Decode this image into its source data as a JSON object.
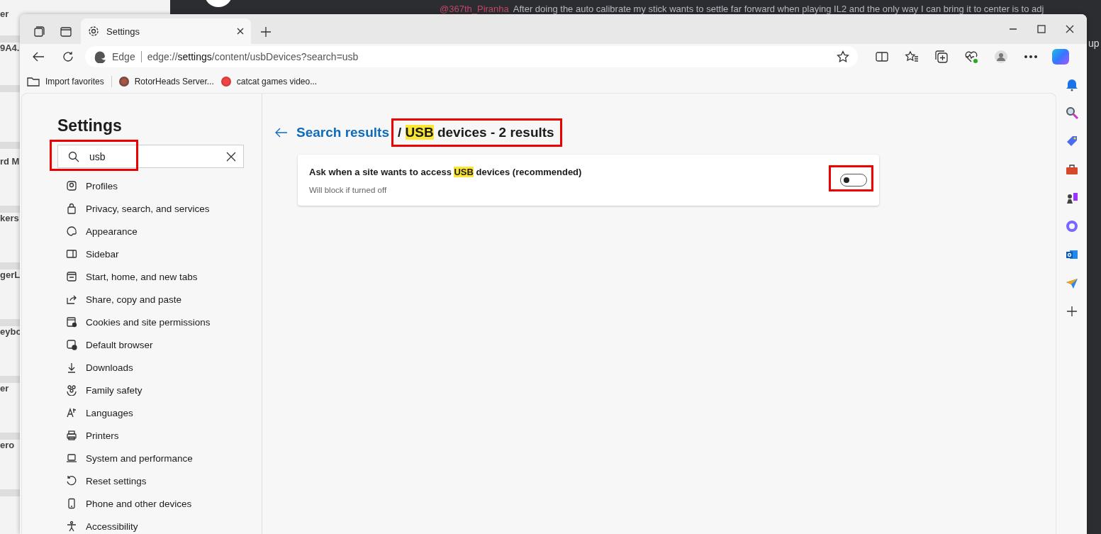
{
  "desktop": {
    "left_labels": [
      "er",
      "9A4.",
      "rd M",
      "kers",
      "gerL",
      "eybo",
      "er",
      "ero"
    ]
  },
  "chat": {
    "author": "@367th_Piranha",
    "message": "After doing the auto calibrate my stick wants to settle far forward when playing IL2 and the only way I can bring it to center is to adj",
    "side_text": "up"
  },
  "browser": {
    "tabs": [
      {
        "label": "Settings",
        "selected": true
      }
    ],
    "address": {
      "site_label": "Edge",
      "url": "edge://**settings**/content/usbDevices?search=usb"
    },
    "favorites": [
      {
        "label": "Import favorites",
        "kind": "import"
      },
      {
        "label": "RotorHeads Server...",
        "kind": "site"
      },
      {
        "label": "catcat games video...",
        "kind": "site"
      }
    ],
    "settings": {
      "title": "Settings",
      "search": {
        "value": "usb",
        "annotated": true
      },
      "nav": [
        {
          "label": "Profiles"
        },
        {
          "label": "Privacy, search, and services"
        },
        {
          "label": "Appearance"
        },
        {
          "label": "Sidebar"
        },
        {
          "label": "Start, home, and new tabs"
        },
        {
          "label": "Share, copy and paste"
        },
        {
          "label": "Cookies and site permissions"
        },
        {
          "label": "Default browser"
        },
        {
          "label": "Downloads"
        },
        {
          "label": "Family safety"
        },
        {
          "label": "Languages"
        },
        {
          "label": "Printers"
        },
        {
          "label": "System and performance"
        },
        {
          "label": "Reset settings"
        },
        {
          "label": "Phone and other devices"
        },
        {
          "label": "Accessibility"
        }
      ]
    },
    "results": {
      "back_link": "Search results",
      "annotated": true,
      "heading": [
        {
          "text": "/ ",
          "highlighted": false
        },
        {
          "text": "USB",
          "highlighted": true
        },
        {
          "text": " devices - 2 results",
          "highlighted": false
        }
      ],
      "items": [
        {
          "title": [
            {
              "text": "Ask when a site wants to access ",
              "highlighted": false
            },
            {
              "text": "USB",
              "highlighted": true
            },
            {
              "text": " devices (recommended)",
              "highlighted": false
            }
          ],
          "description": "Will block if turned off",
          "on": false,
          "annotated": true
        }
      ]
    }
  }
}
